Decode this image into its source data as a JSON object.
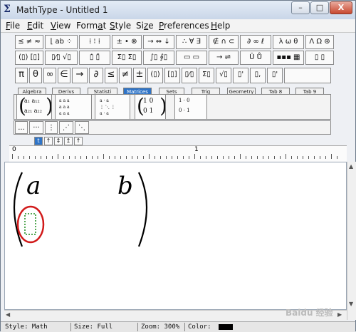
{
  "window": {
    "title": "MathType - Untitled 1",
    "app_icon": "sigma-icon"
  },
  "titlebar_buttons": {
    "minimize": "–",
    "maximize": "□",
    "close": "X"
  },
  "menu": {
    "items": [
      {
        "label": "File",
        "accel": "F",
        "rest": "ile"
      },
      {
        "label": "Edit",
        "accel": "E",
        "rest": "dit"
      },
      {
        "label": "View",
        "accel": "V",
        "rest": "iew"
      },
      {
        "label": "Format",
        "pre": "Form",
        "accel": "a",
        "rest": "t"
      },
      {
        "label": "Style",
        "accel": "S",
        "rest": "tyle"
      },
      {
        "label": "Size",
        "pre": "Si",
        "accel": "z",
        "rest": "e"
      },
      {
        "label": "Preferences",
        "accel": "P",
        "rest": "references"
      },
      {
        "label": "Help",
        "accel": "H",
        "rest": "elp"
      }
    ]
  },
  "symbol_palettes_row1": [
    "≤ ≠ ≈",
    "⌊ ab ⁘",
    "⁞ ⁝ ⁞",
    "± • ⊗",
    "→ ⇔ ↓",
    "∴ ∀ ∃",
    "∉ ∩ ⊂",
    "∂ ∞ ℓ",
    "λ ω θ",
    "Λ Ω ⊛"
  ],
  "template_palettes_row2": [
    "(▯) [▯]",
    "▯⁄▯ √▯",
    "▯̇ ▯̄",
    "Σ▯ Σ▯",
    "∫▯ ∮▯",
    "▭ ▭",
    "→ ⇌",
    "Ū Ů",
    "▪▪▪ ▦",
    "▯ ▯"
  ],
  "small_bar": [
    "π",
    "θ",
    "∞",
    "∈",
    "→",
    "∂",
    "≤",
    "≠",
    "±",
    "(▯)",
    "[▯]",
    "▯⁄▯",
    "Σ▯",
    "√▯",
    "▯'",
    "▯,",
    "▯'"
  ],
  "tabs": [
    {
      "label": "Algebra",
      "active": false
    },
    {
      "label": "Derivs",
      "active": false
    },
    {
      "label": "Statisti",
      "active": false
    },
    {
      "label": "Matrices",
      "active": true
    },
    {
      "label": "Sets",
      "active": false
    },
    {
      "label": "Trig",
      "active": false
    },
    {
      "label": "Geometry",
      "active": false
    },
    {
      "label": "Tab 8",
      "active": false
    },
    {
      "label": "Tab 9",
      "active": false
    }
  ],
  "matrix_templates": {
    "t1_r1": "a₁  a₁₂",
    "t1_r2": "a₂₁  a₂₂",
    "t4_r1": "1   0",
    "t4_r2": "0   1",
    "t5_r1": "1  ·  0",
    "t5_r2": "0  ·  1"
  },
  "dots_bar": [
    "...",
    "···",
    "⋮",
    "⋰",
    "⋱"
  ],
  "size_buttons": [
    "t",
    "↑",
    "↕",
    "↥",
    "↑"
  ],
  "ruler": {
    "label_0": "0",
    "label_1": "1"
  },
  "equation": {
    "cell_11": "a",
    "cell_12": "b",
    "left_paren": "(",
    "right_paren": ")"
  },
  "status": {
    "style": "Style: Math",
    "size": "Size: Full",
    "zoom": "Zoom: 300%",
    "color": "Color:"
  },
  "watermark": "Baidu 经验",
  "colors": {
    "highlight_circle": "#d11a1a",
    "placeholder_dash": "#1a8a1a",
    "active_tab": "#2f74c7"
  }
}
